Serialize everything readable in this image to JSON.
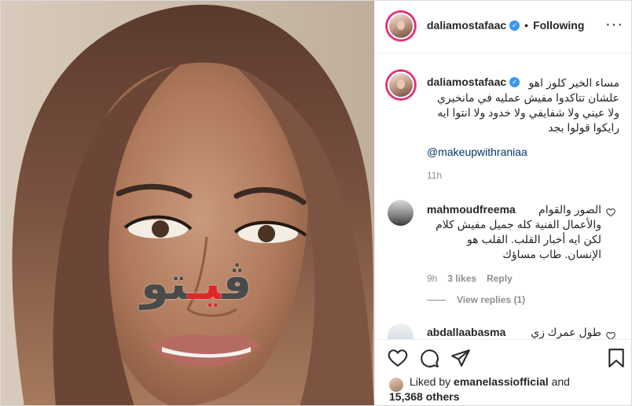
{
  "post": {
    "username": "daliamostafaac",
    "separator": "•",
    "follow_status": "Following",
    "more_icon": "more-horizontal-icon"
  },
  "watermark": {
    "text_part1": "ڤ",
    "text_accent": "يـ",
    "text_part2": "تو"
  },
  "caption": {
    "username": "daliamostafaac",
    "lines": [
      "مساء الخير كلوز اهو",
      "علشان تتاكدوا مفيش عمليه في مانخيري",
      "ولا عيني ولا شفايفي ولا خدود ولا انتوا ايه",
      "رايكوا قولوا بجد"
    ],
    "mention": "@makeupwithraniaa",
    "time": "11h"
  },
  "comments": [
    {
      "username": "mahmoudfreema",
      "lines": [
        "الصور والقوام",
        "والأعمال الفنية كله جميل مفيش كلام",
        "لكن ايه أخبار القلب. القلب هو",
        "الإنسان. طاب مساؤك"
      ],
      "time": "9h",
      "likes": "3 likes",
      "reply": "Reply",
      "view_replies": "View replies (1)"
    },
    {
      "username": "abdallaabasma",
      "lines": [
        "طول عمرك زي"
      ]
    }
  ],
  "likes": {
    "prefix": "Liked by",
    "user": "emanelassiofficial",
    "and": "and",
    "others": "15,368 others"
  },
  "colors": {
    "link": "#00376b",
    "verified": "#3897f0",
    "muted": "#8e8e8e",
    "watermark_accent": "#e0262b"
  }
}
